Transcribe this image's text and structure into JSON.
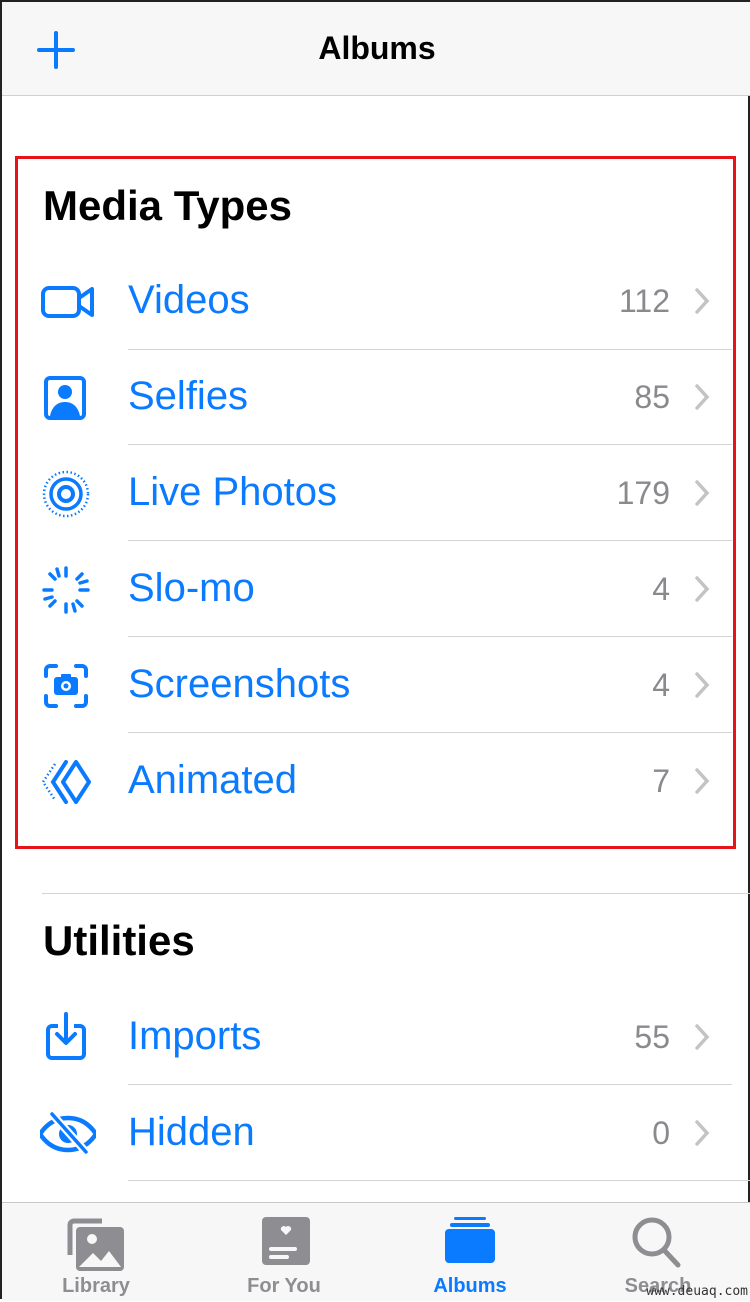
{
  "header": {
    "title": "Albums",
    "add_icon": "plus-icon"
  },
  "colors": {
    "accent": "#0a7aff",
    "highlight": "#e8121b",
    "count": "#8a8a8e"
  },
  "sections": [
    {
      "title": "Media Types",
      "items": [
        {
          "label": "Videos",
          "count": "112",
          "icon": "video-camera-icon"
        },
        {
          "label": "Selfies",
          "count": "85",
          "icon": "selfie-portrait-icon"
        },
        {
          "label": "Live Photos",
          "count": "179",
          "icon": "live-photo-icon"
        },
        {
          "label": "Slo-mo",
          "count": "4",
          "icon": "slo-mo-icon"
        },
        {
          "label": "Screenshots",
          "count": "4",
          "icon": "screenshot-icon"
        },
        {
          "label": "Animated",
          "count": "7",
          "icon": "animated-icon"
        }
      ]
    },
    {
      "title": "Utilities",
      "items": [
        {
          "label": "Imports",
          "count": "55",
          "icon": "import-icon"
        },
        {
          "label": "Hidden",
          "count": "0",
          "icon": "eye-slash-icon"
        }
      ]
    }
  ],
  "tabs": [
    {
      "label": "Library",
      "icon": "photo-library-icon",
      "active": false
    },
    {
      "label": "For You",
      "icon": "for-you-icon",
      "active": false
    },
    {
      "label": "Albums",
      "icon": "albums-icon",
      "active": true
    },
    {
      "label": "Search",
      "icon": "search-icon",
      "active": false
    }
  ],
  "watermark": "www.deuaq.com"
}
